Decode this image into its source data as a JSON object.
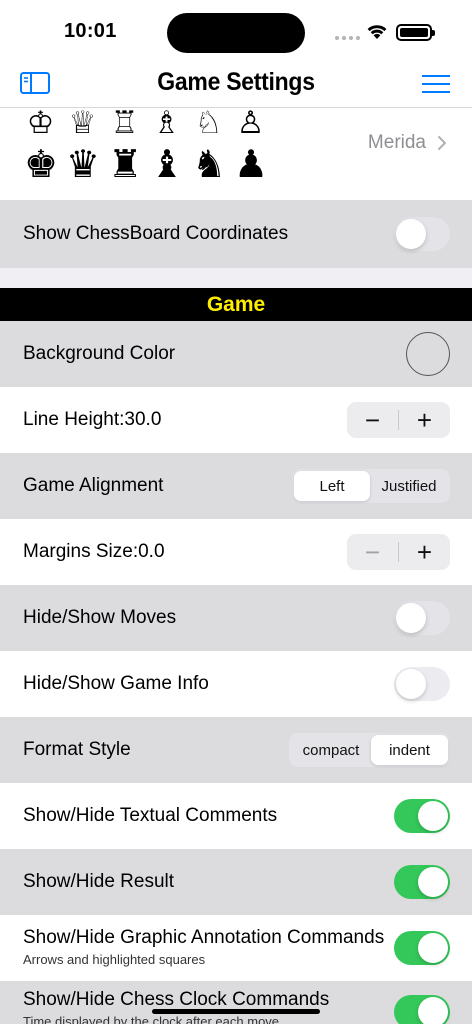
{
  "status": {
    "time": "10:01"
  },
  "nav": {
    "title": "Game Settings"
  },
  "pieces": {
    "white": [
      "♔",
      "♕",
      "♖",
      "♗",
      "♘",
      "♙"
    ],
    "black": [
      "♚",
      "♛",
      "♜",
      "♝",
      "♞",
      "♟"
    ],
    "value": "Merida"
  },
  "board": {
    "show_coordinates_label": "Show ChessBoard Coordinates",
    "show_coordinates": false
  },
  "section": {
    "game_title": "Game"
  },
  "game": {
    "background_color_label": "Background Color",
    "background_color": "#dcdcdf",
    "line_height_label": "Line Height:30.0",
    "alignment_label": "Game Alignment",
    "alignment_options": [
      "Left",
      "Justified"
    ],
    "alignment_selected": "Left",
    "margins_label": "Margins Size:0.0",
    "hide_moves_label": "Hide/Show Moves",
    "hide_moves": false,
    "hide_game_info_label": "Hide/Show Game Info",
    "hide_game_info": false,
    "format_style_label": "Format Style",
    "format_options": [
      "compact",
      "indent"
    ],
    "format_selected": "indent",
    "textual_comments_label": "Show/Hide Textual Comments",
    "textual_comments": true,
    "result_label": "Show/Hide Result",
    "result": true,
    "graphic_annotation_label": "Show/Hide Graphic Annotation Commands",
    "graphic_annotation_sub": "Arrows and highlighted squares",
    "graphic_annotation": true,
    "clock_label": "Show/Hide Chess Clock Commands",
    "clock_sub": "Time displayed by the clock after each move",
    "clock": true
  },
  "stepper": {
    "minus": "−",
    "plus": "+"
  },
  "colors": {
    "accent": "#007aff",
    "toggle_on": "#34c759",
    "section_header_bg": "#000000",
    "section_header_text": "#ffee00"
  }
}
